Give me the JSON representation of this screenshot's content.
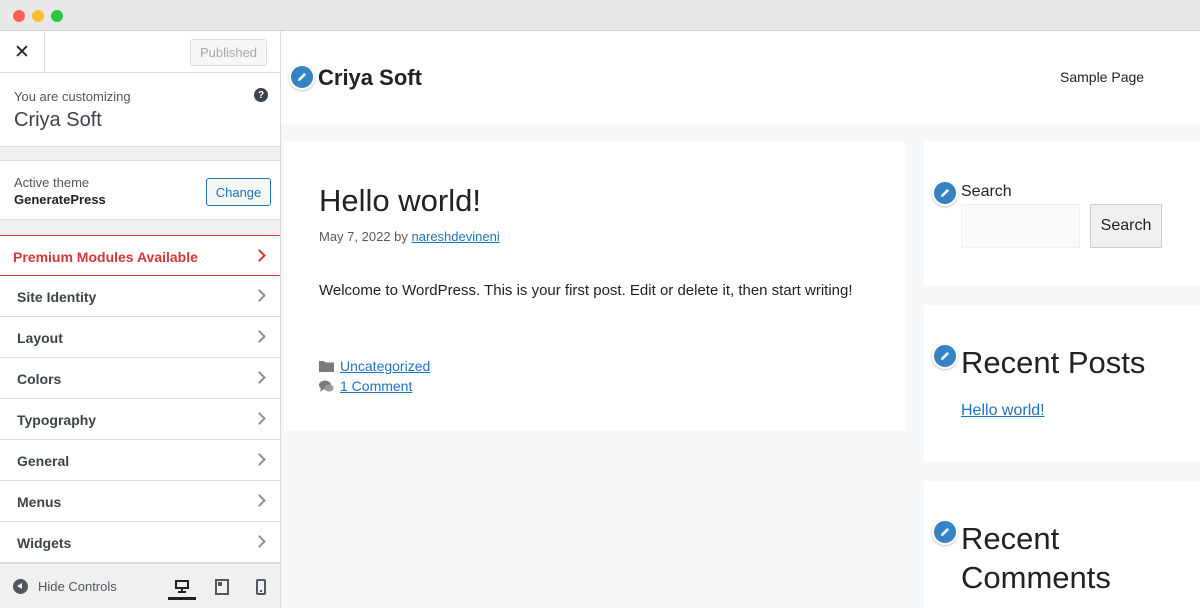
{
  "window": {
    "controls": [
      "close",
      "minimize",
      "maximize"
    ]
  },
  "customizer": {
    "close_icon": "close-icon",
    "publish_button": "Published",
    "customizing_label": "You are customizing",
    "site_name": "Criya Soft",
    "active_theme_label": "Active theme",
    "active_theme_name": "GeneratePress",
    "change_button": "Change",
    "sections": [
      {
        "label": "Premium Modules Available",
        "highlight": true
      },
      {
        "label": "Site Identity"
      },
      {
        "label": "Layout"
      },
      {
        "label": "Colors"
      },
      {
        "label": "Typography"
      },
      {
        "label": "General"
      },
      {
        "label": "Menus"
      },
      {
        "label": "Widgets"
      }
    ],
    "hide_controls": "Hide Controls",
    "devices": [
      "desktop",
      "tablet",
      "mobile"
    ],
    "active_device": "desktop",
    "colors": {
      "accent": "#2271b1",
      "premium": "#d63638"
    }
  },
  "preview": {
    "site_title": "Criya Soft",
    "nav": [
      "Sample Page"
    ],
    "post": {
      "title": "Hello world!",
      "date": "May 7, 2022",
      "by": "by",
      "author": "nareshdevineni",
      "body": "Welcome to WordPress. This is your first post. Edit or delete it, then start writing!",
      "category": "Uncategorized",
      "comments": "1 Comment"
    },
    "search_widget": {
      "label": "Search",
      "button": "Search"
    },
    "recent_posts": {
      "title": "Recent Posts",
      "items": [
        "Hello world!"
      ]
    },
    "recent_comments": {
      "title": "Recent Comments"
    },
    "colors": {
      "link": "#1e73be",
      "edit_shortcut": "#3582c4"
    }
  }
}
